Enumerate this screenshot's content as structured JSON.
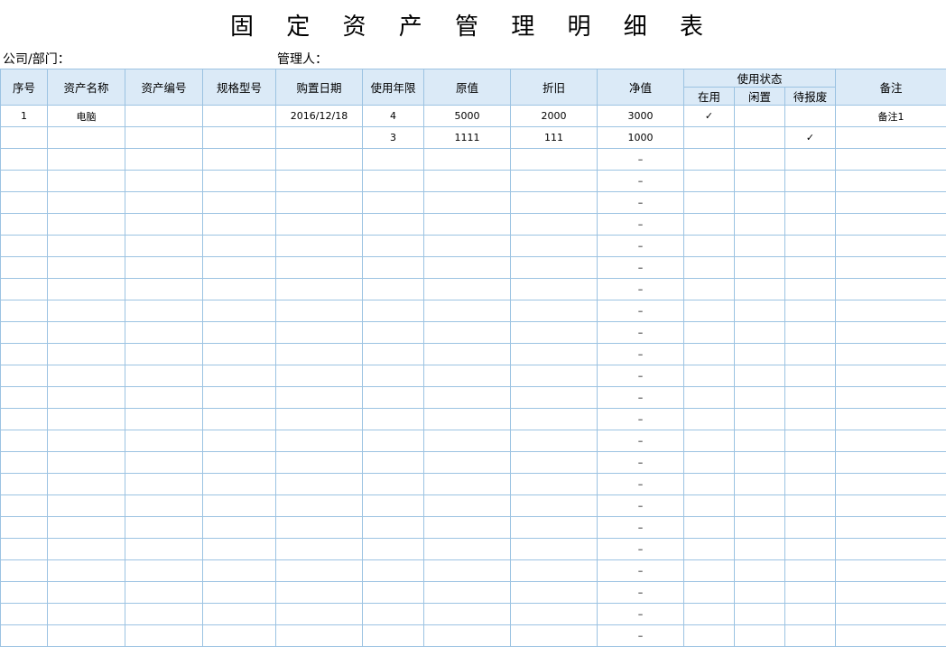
{
  "title": "固 定 资 产 管 理 明 细 表",
  "meta": {
    "company_label": "公司/部门：",
    "manager_label": "管理人："
  },
  "headers": {
    "seq": "序号",
    "name": "资产名称",
    "code": "资产编号",
    "model": "规格型号",
    "date": "购置日期",
    "years": "使用年限",
    "original": "原值",
    "depreciation": "折旧",
    "net": "净值",
    "status_group": "使用状态",
    "status_in_use": "在用",
    "status_idle": "闲置",
    "status_scrap": "待报废",
    "remark": "备注"
  },
  "rows": [
    {
      "seq": "1",
      "name": "电脑",
      "code": "",
      "model": "",
      "date": "2016/12/18",
      "years": "4",
      "original": "5000",
      "depreciation": "2000",
      "net": "3000",
      "in_use": "✓",
      "idle": "",
      "scrap": "",
      "remark": "备注1"
    },
    {
      "seq": "",
      "name": "",
      "code": "",
      "model": "",
      "date": "",
      "years": "3",
      "original": "1111",
      "depreciation": "111",
      "net": "1000",
      "in_use": "",
      "idle": "",
      "scrap": "✓",
      "remark": ""
    },
    {
      "seq": "",
      "name": "",
      "code": "",
      "model": "",
      "date": "",
      "years": "",
      "original": "",
      "depreciation": "",
      "net": "–",
      "in_use": "",
      "idle": "",
      "scrap": "",
      "remark": ""
    },
    {
      "seq": "",
      "name": "",
      "code": "",
      "model": "",
      "date": "",
      "years": "",
      "original": "",
      "depreciation": "",
      "net": "–",
      "in_use": "",
      "idle": "",
      "scrap": "",
      "remark": ""
    },
    {
      "seq": "",
      "name": "",
      "code": "",
      "model": "",
      "date": "",
      "years": "",
      "original": "",
      "depreciation": "",
      "net": "–",
      "in_use": "",
      "idle": "",
      "scrap": "",
      "remark": ""
    },
    {
      "seq": "",
      "name": "",
      "code": "",
      "model": "",
      "date": "",
      "years": "",
      "original": "",
      "depreciation": "",
      "net": "–",
      "in_use": "",
      "idle": "",
      "scrap": "",
      "remark": ""
    },
    {
      "seq": "",
      "name": "",
      "code": "",
      "model": "",
      "date": "",
      "years": "",
      "original": "",
      "depreciation": "",
      "net": "–",
      "in_use": "",
      "idle": "",
      "scrap": "",
      "remark": ""
    },
    {
      "seq": "",
      "name": "",
      "code": "",
      "model": "",
      "date": "",
      "years": "",
      "original": "",
      "depreciation": "",
      "net": "–",
      "in_use": "",
      "idle": "",
      "scrap": "",
      "remark": ""
    },
    {
      "seq": "",
      "name": "",
      "code": "",
      "model": "",
      "date": "",
      "years": "",
      "original": "",
      "depreciation": "",
      "net": "–",
      "in_use": "",
      "idle": "",
      "scrap": "",
      "remark": ""
    },
    {
      "seq": "",
      "name": "",
      "code": "",
      "model": "",
      "date": "",
      "years": "",
      "original": "",
      "depreciation": "",
      "net": "–",
      "in_use": "",
      "idle": "",
      "scrap": "",
      "remark": ""
    },
    {
      "seq": "",
      "name": "",
      "code": "",
      "model": "",
      "date": "",
      "years": "",
      "original": "",
      "depreciation": "",
      "net": "–",
      "in_use": "",
      "idle": "",
      "scrap": "",
      "remark": ""
    },
    {
      "seq": "",
      "name": "",
      "code": "",
      "model": "",
      "date": "",
      "years": "",
      "original": "",
      "depreciation": "",
      "net": "–",
      "in_use": "",
      "idle": "",
      "scrap": "",
      "remark": ""
    },
    {
      "seq": "",
      "name": "",
      "code": "",
      "model": "",
      "date": "",
      "years": "",
      "original": "",
      "depreciation": "",
      "net": "–",
      "in_use": "",
      "idle": "",
      "scrap": "",
      "remark": ""
    },
    {
      "seq": "",
      "name": "",
      "code": "",
      "model": "",
      "date": "",
      "years": "",
      "original": "",
      "depreciation": "",
      "net": "–",
      "in_use": "",
      "idle": "",
      "scrap": "",
      "remark": ""
    },
    {
      "seq": "",
      "name": "",
      "code": "",
      "model": "",
      "date": "",
      "years": "",
      "original": "",
      "depreciation": "",
      "net": "–",
      "in_use": "",
      "idle": "",
      "scrap": "",
      "remark": ""
    },
    {
      "seq": "",
      "name": "",
      "code": "",
      "model": "",
      "date": "",
      "years": "",
      "original": "",
      "depreciation": "",
      "net": "–",
      "in_use": "",
      "idle": "",
      "scrap": "",
      "remark": ""
    },
    {
      "seq": "",
      "name": "",
      "code": "",
      "model": "",
      "date": "",
      "years": "",
      "original": "",
      "depreciation": "",
      "net": "–",
      "in_use": "",
      "idle": "",
      "scrap": "",
      "remark": ""
    },
    {
      "seq": "",
      "name": "",
      "code": "",
      "model": "",
      "date": "",
      "years": "",
      "original": "",
      "depreciation": "",
      "net": "–",
      "in_use": "",
      "idle": "",
      "scrap": "",
      "remark": ""
    },
    {
      "seq": "",
      "name": "",
      "code": "",
      "model": "",
      "date": "",
      "years": "",
      "original": "",
      "depreciation": "",
      "net": "–",
      "in_use": "",
      "idle": "",
      "scrap": "",
      "remark": ""
    },
    {
      "seq": "",
      "name": "",
      "code": "",
      "model": "",
      "date": "",
      "years": "",
      "original": "",
      "depreciation": "",
      "net": "–",
      "in_use": "",
      "idle": "",
      "scrap": "",
      "remark": ""
    },
    {
      "seq": "",
      "name": "",
      "code": "",
      "model": "",
      "date": "",
      "years": "",
      "original": "",
      "depreciation": "",
      "net": "–",
      "in_use": "",
      "idle": "",
      "scrap": "",
      "remark": ""
    },
    {
      "seq": "",
      "name": "",
      "code": "",
      "model": "",
      "date": "",
      "years": "",
      "original": "",
      "depreciation": "",
      "net": "–",
      "in_use": "",
      "idle": "",
      "scrap": "",
      "remark": ""
    },
    {
      "seq": "",
      "name": "",
      "code": "",
      "model": "",
      "date": "",
      "years": "",
      "original": "",
      "depreciation": "",
      "net": "–",
      "in_use": "",
      "idle": "",
      "scrap": "",
      "remark": ""
    },
    {
      "seq": "",
      "name": "",
      "code": "",
      "model": "",
      "date": "",
      "years": "",
      "original": "",
      "depreciation": "",
      "net": "–",
      "in_use": "",
      "idle": "",
      "scrap": "",
      "remark": ""
    },
    {
      "seq": "",
      "name": "",
      "code": "",
      "model": "",
      "date": "",
      "years": "",
      "original": "",
      "depreciation": "",
      "net": "–",
      "in_use": "",
      "idle": "",
      "scrap": "",
      "remark": ""
    }
  ],
  "colors": {
    "grid_line": "#9cc3e2",
    "header_fill": "#dbeaf7"
  }
}
